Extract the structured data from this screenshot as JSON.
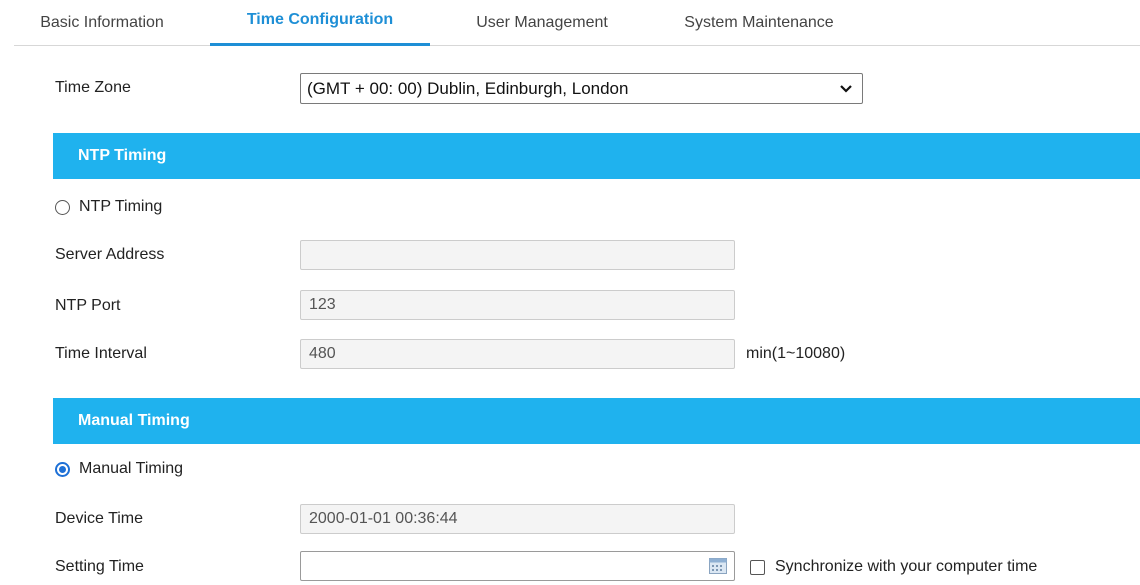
{
  "tabs": [
    {
      "label": "Basic Information",
      "active": false
    },
    {
      "label": "Time Configuration",
      "active": true
    },
    {
      "label": "User Management",
      "active": false
    },
    {
      "label": "System Maintenance",
      "active": false
    }
  ],
  "time_zone": {
    "label": "Time Zone",
    "selected": "(GMT + 00: 00) Dublin, Edinburgh, London"
  },
  "ntp": {
    "section_title": "NTP Timing",
    "radio_label": "NTP Timing",
    "radio_checked": false,
    "server_address": {
      "label": "Server Address",
      "value": ""
    },
    "port": {
      "label": "NTP Port",
      "value": "123"
    },
    "interval": {
      "label": "Time Interval",
      "value": "480",
      "unit": "min(1~10080)"
    }
  },
  "manual": {
    "section_title": "Manual Timing",
    "radio_label": "Manual Timing",
    "radio_checked": true,
    "device_time": {
      "label": "Device Time",
      "value": "2000-01-01 00:36:44"
    },
    "setting_time": {
      "label": "Setting Time",
      "value": ""
    },
    "sync_label": "Synchronize with your computer time",
    "sync_checked": false
  },
  "colors": {
    "accent": "#1e8fd6",
    "section_bar": "#1fb2ee",
    "radio_selected": "#1e70d6"
  },
  "icons": [
    "chevron-down-icon",
    "calendar-icon"
  ]
}
